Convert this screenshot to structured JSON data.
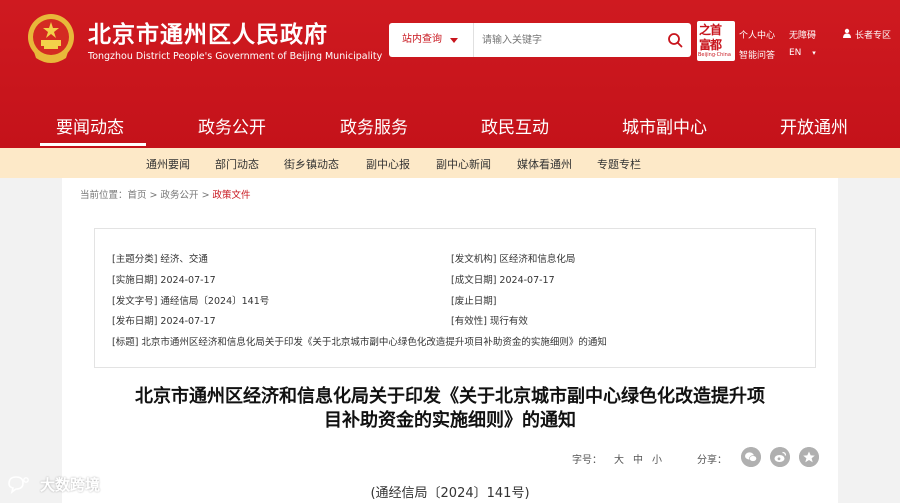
{
  "header": {
    "site_title": "北京市通州区人民政府",
    "site_subtitle": "Tongzhou District People's Government of Beijing Municipality",
    "search_scope": "站内查询",
    "search_placeholder": "请输入关键字",
    "logo_line1": "之首",
    "logo_line2": "富都",
    "logo_line3": "Beijing·China",
    "links": {
      "personal_center": "个人中心",
      "accessibility": "无障碍",
      "smart_qa": "智能问答",
      "language": "EN",
      "elder_zone": "长者专区"
    }
  },
  "main_nav": [
    "要闻动态",
    "政务公开",
    "政务服务",
    "政民互动",
    "城市副中心",
    "开放通州"
  ],
  "sub_nav": [
    "通州要闻",
    "部门动态",
    "街乡镇动态",
    "副中心报",
    "副中心新闻",
    "媒体看通州",
    "专题专栏"
  ],
  "breadcrumb": {
    "prefix": "当前位置：",
    "home": "首页",
    "sep1": " > ",
    "section": "政务公开",
    "sep2": " > ",
    "current": "政策文件"
  },
  "meta": {
    "topic": "[主题分类] 经济、交通",
    "issuer": "[发文机构] 区经济和信息化局",
    "effective_date": "[实施日期] 2024-07-17",
    "written_date": "[成文日期] 2024-07-17",
    "doc_number": "[发文字号] 通经信局〔2024〕141号",
    "repeal_date": "[废止日期]",
    "publish_date": "[发布日期] 2024-07-17",
    "validity": "[有效性] 现行有效",
    "title_field": "[标题] 北京市通州区经济和信息化局关于印发《关于北京城市副中心绿色化改造提升项目补助资金的实施细则》的通知"
  },
  "article": {
    "title_line1": "北京市通州区经济和信息化局关于印发《关于北京城市副中心绿色化改造提升项",
    "title_line2": "目补助资金的实施细则》的通知",
    "font_size_label": "字号：",
    "size_large": "大",
    "size_medium": "中",
    "size_small": "小",
    "share_label": "分享：",
    "doc_number": "(通经信局〔2024〕141号)"
  },
  "watermark": "大数跨境",
  "colors": {
    "brand_red": "#c8151d",
    "subnav_bg": "#fde9c8",
    "page_bg": "#f2f2f2"
  },
  "icons": [
    "national-emblem",
    "search-icon",
    "user-icon",
    "wechat-icon",
    "weibo-icon",
    "qq-icon"
  ]
}
